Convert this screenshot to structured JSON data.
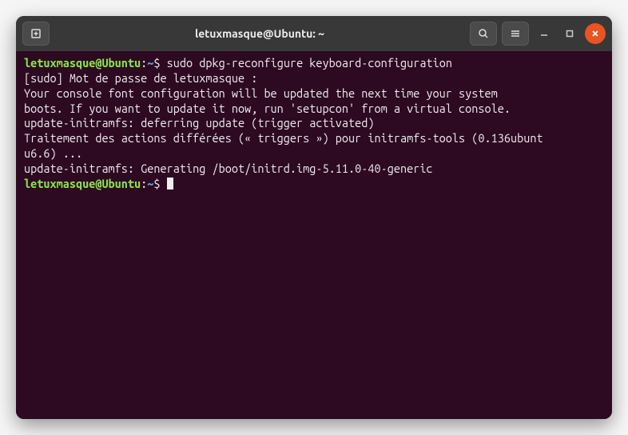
{
  "titlebar": {
    "title": "letuxmasque@Ubuntu: ~"
  },
  "prompt": {
    "user_host": "letuxmasque@Ubuntu",
    "colon": ":",
    "path": "~",
    "dollar": "$ "
  },
  "command1": "sudo dpkg-reconfigure keyboard-configuration",
  "output": {
    "l1": "[sudo] Mot de passe de letuxmasque :",
    "l2": "Your console font configuration will be updated the next time your system ",
    "l3": "boots. If you want to update it now, run 'setupcon' from a virtual console.",
    "l4": "update-initramfs: deferring update (trigger activated)",
    "l5": "Traitement des actions différées (« triggers ») pour initramfs-tools (0.136ubunt",
    "l6": "u6.6) ...",
    "l7": "update-initramfs: Generating /boot/initrd.img-5.11.0-40-generic"
  }
}
